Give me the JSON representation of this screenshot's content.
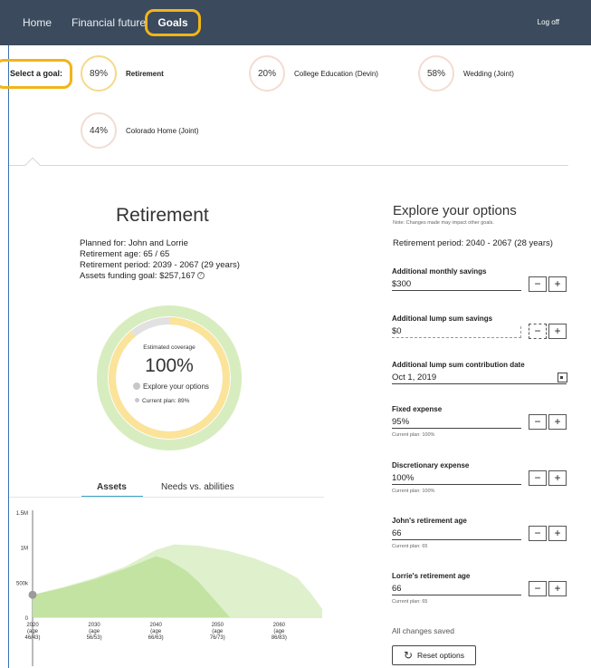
{
  "nav": {
    "home": "Home",
    "financial_future": "Financial future",
    "goals": "Goals",
    "logoff": "Log off"
  },
  "goals": {
    "select_label": "Select a goal:",
    "items": [
      {
        "pct": "89%",
        "name": "Retirement"
      },
      {
        "pct": "20%",
        "name": "College Education (Devin)"
      },
      {
        "pct": "58%",
        "name": "Wedding (Joint)"
      },
      {
        "pct": "44%",
        "name": "Colorado Home (Joint)"
      }
    ]
  },
  "retirement": {
    "title": "Retirement",
    "planned_for": "Planned for:  John and Lorrie",
    "retirement_age": "Retirement age:  65 / 65",
    "retirement_period": "Retirement period:  2039 - 2067 (29 years)",
    "assets_funding_goal": "Assets funding goal:  $257,167",
    "coverage_label": "Estimated coverage",
    "coverage_value": "100%",
    "explore_legend": "Explore your options",
    "current_legend": "Current plan: 89%",
    "coverage_explore": 1.0,
    "coverage_current": 0.89
  },
  "tabs": {
    "assets": "Assets",
    "needs": "Needs vs. abilities"
  },
  "chart_data": {
    "type": "area",
    "y_ticks": [
      "1.5M",
      "1M",
      "500k",
      "0"
    ],
    "ylim": [
      0,
      1500000
    ],
    "x_ticks": [
      {
        "year": "2020",
        "age": "(age",
        "ages": "46/43)"
      },
      {
        "year": "2030",
        "age": "(age",
        "ages": "56/53)"
      },
      {
        "year": "2040",
        "age": "(age",
        "ages": "66/63)"
      },
      {
        "year": "2050",
        "age": "(age",
        "ages": "76/73)"
      },
      {
        "year": "2060",
        "age": "(age",
        "ages": "86/83)"
      }
    ],
    "xlim": [
      2020,
      2067
    ],
    "series": [
      {
        "name": "Explore your options",
        "color": "#dff0cc",
        "x": [
          2020,
          2025,
          2030,
          2035,
          2040,
          2043,
          2047,
          2052,
          2056,
          2060,
          2063,
          2065,
          2067
        ],
        "values": [
          320000,
          430000,
          560000,
          720000,
          960000,
          1040000,
          1020000,
          940000,
          840000,
          700000,
          560000,
          360000,
          120000
        ]
      },
      {
        "name": "Current plan",
        "color": "#c3e3a2",
        "x": [
          2020,
          2025,
          2030,
          2035,
          2040,
          2042,
          2045,
          2047,
          2050,
          2052
        ],
        "values": [
          320000,
          420000,
          540000,
          690000,
          870000,
          820000,
          660000,
          500000,
          200000,
          0
        ]
      }
    ],
    "marker": {
      "x": 2020,
      "y": 320000,
      "color": "#9b9b9b"
    }
  },
  "explore": {
    "title": "Explore your options",
    "note": "Note: Changes made may impact other goals.",
    "period": "Retirement period: 2040 - 2067 (28 years)",
    "fields": [
      {
        "label": "Additional monthly savings",
        "value": "$300",
        "sub": ""
      },
      {
        "label": "Additional lump sum savings",
        "value": "$0",
        "sub": ""
      },
      {
        "label": "Additional lump sum contribution date",
        "value": "Oct 1, 2019",
        "sub": ""
      },
      {
        "label": "Fixed expense",
        "value": "95%",
        "sub": "Current plan: 100%"
      },
      {
        "label": "Discretionary expense",
        "value": "100%",
        "sub": "Current plan: 100%"
      },
      {
        "label": "John's retirement age",
        "value": "66",
        "sub": "Current plan: 65"
      },
      {
        "label": "Lorrie's retirement age",
        "value": "66",
        "sub": "Current plan: 65"
      }
    ],
    "minus": "−",
    "plus": "+",
    "status": "All changes saved",
    "reset_label": "Reset options"
  }
}
